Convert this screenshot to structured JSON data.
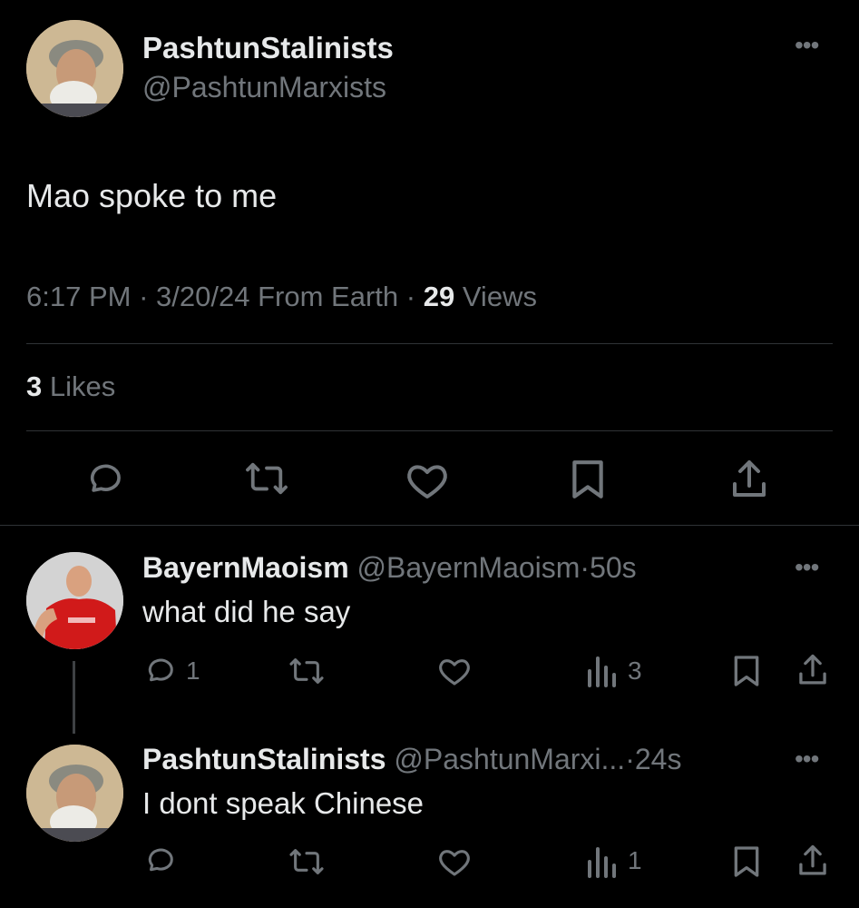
{
  "main_tweet": {
    "display_name": "PashtunStalinists",
    "handle": "@PashtunMarxists",
    "text": "Mao spoke to me",
    "time": "6:17 PM",
    "date": "3/20/24",
    "source": "From Earth",
    "views_count": "29",
    "views_label": "Views",
    "likes_count": "3",
    "likes_label": "Likes",
    "sep": "·"
  },
  "replies": [
    {
      "display_name": "BayernMaoism",
      "handle": "@BayernMaoism",
      "time": "50s",
      "text": "what did he say",
      "reply_count": "1",
      "views_count": "3"
    },
    {
      "display_name": "PashtunStalinists",
      "handle": "@PashtunMarxi...",
      "time": "24s",
      "text": "I dont speak Chinese",
      "reply_count": "",
      "views_count": "1"
    }
  ],
  "sep": "·",
  "icons": {
    "more": "more-horizontal-icon",
    "reply": "speech-bubble-icon",
    "retweet": "retweet-icon",
    "like": "heart-icon",
    "bookmark": "bookmark-icon",
    "share": "share-icon",
    "views": "bar-chart-icon"
  },
  "colors": {
    "background": "#000000",
    "text": "#e7e9ea",
    "muted": "#71767b",
    "divider": "#2f3336"
  }
}
